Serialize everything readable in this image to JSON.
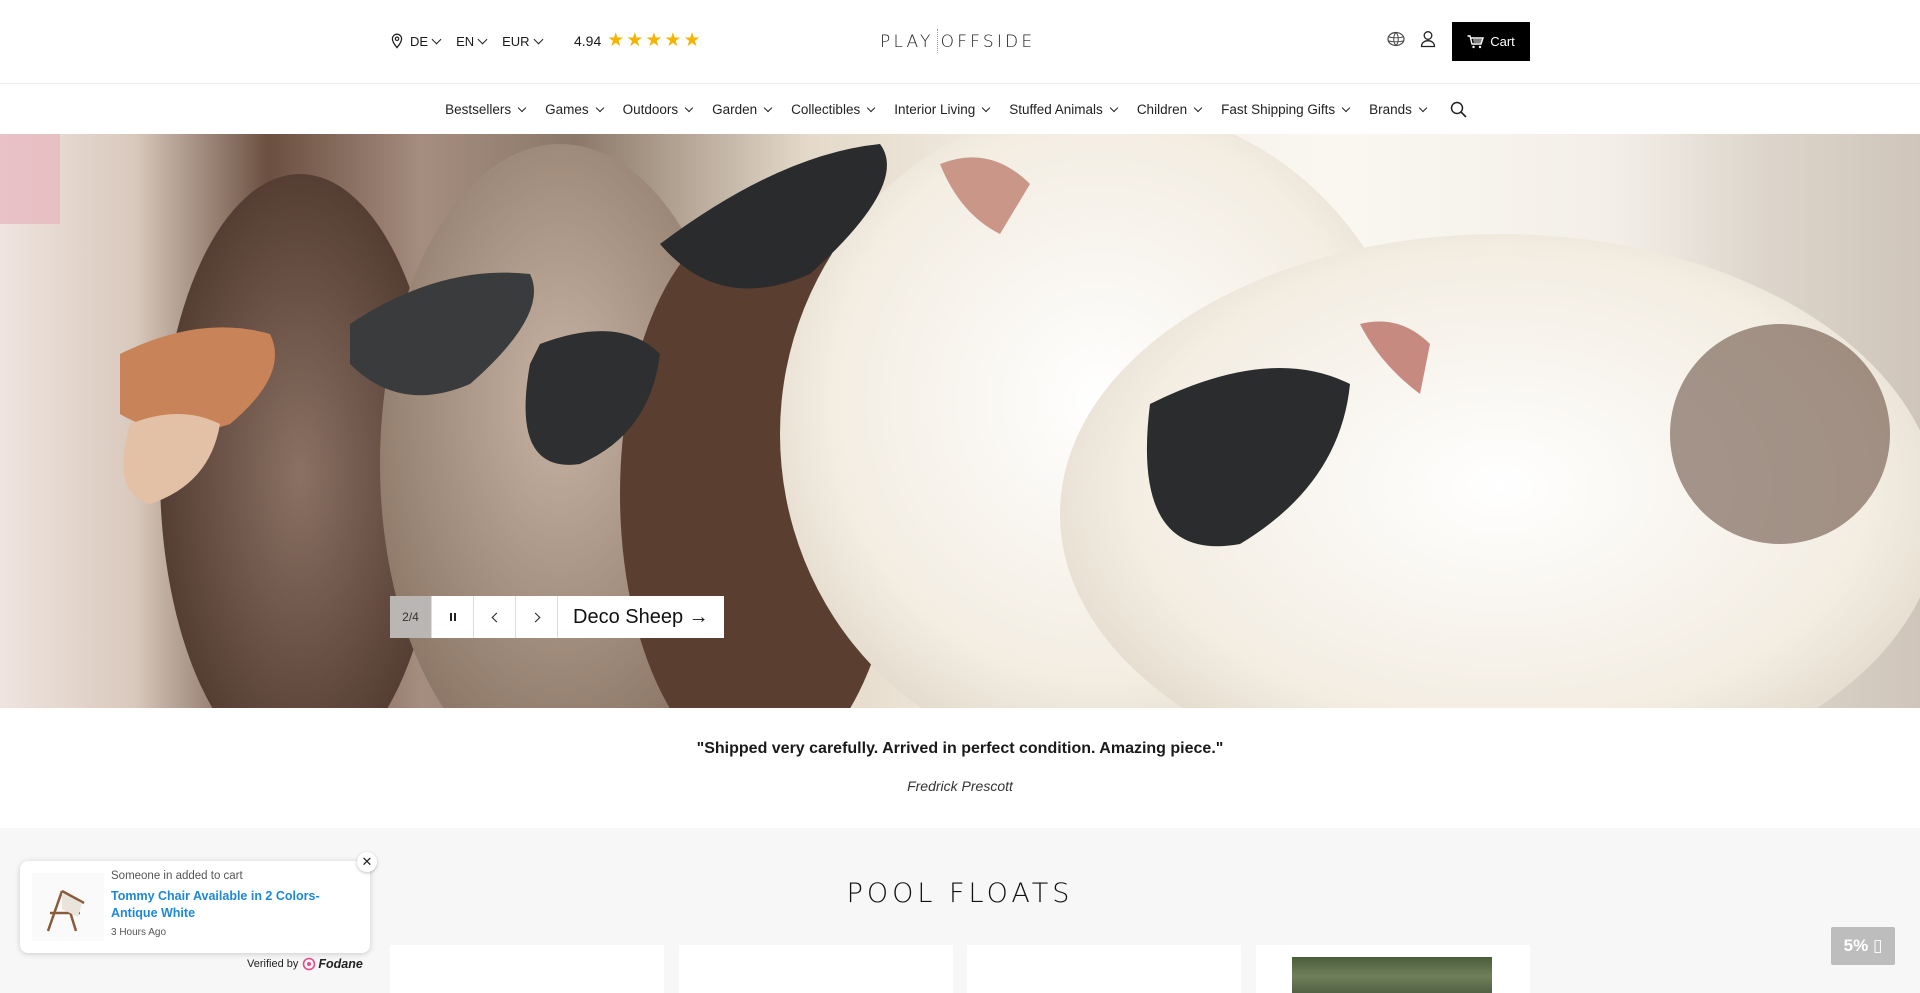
{
  "header": {
    "country": "DE",
    "language": "EN",
    "currency": "EUR",
    "rating": "4.94",
    "rating_stars": 5,
    "logo_left": "PLAY",
    "logo_right": "OFFSIDE",
    "cart_label": "Cart"
  },
  "nav": {
    "items": [
      {
        "label": "Bestsellers"
      },
      {
        "label": "Games"
      },
      {
        "label": "Outdoors"
      },
      {
        "label": "Garden"
      },
      {
        "label": "Collectibles"
      },
      {
        "label": "Interior Living"
      },
      {
        "label": "Stuffed Animals"
      },
      {
        "label": "Children"
      },
      {
        "label": "Fast Shipping Gifts"
      },
      {
        "label": "Brands"
      }
    ]
  },
  "hero": {
    "counter": "2/4",
    "link_label": "Deco Sheep →"
  },
  "testimonial": {
    "quote": "\"Shipped very carefully. Arrived in perfect condition. Amazing piece.\"",
    "author": "Fredrick Prescott"
  },
  "products": {
    "title": "POOL FLOATS"
  },
  "popup": {
    "subtitle": "Someone in added to cart",
    "title": "Tommy Chair Available in 2 Colors- Antique White",
    "time": "3 Hours Ago",
    "close": "✕",
    "verified_by": "Verified by",
    "brand": "Fodane"
  },
  "discount": {
    "label": "5% ▯"
  },
  "colors": {
    "accent_link": "#1e88d6",
    "star": "#f4b400",
    "cart_bg": "#000000"
  }
}
